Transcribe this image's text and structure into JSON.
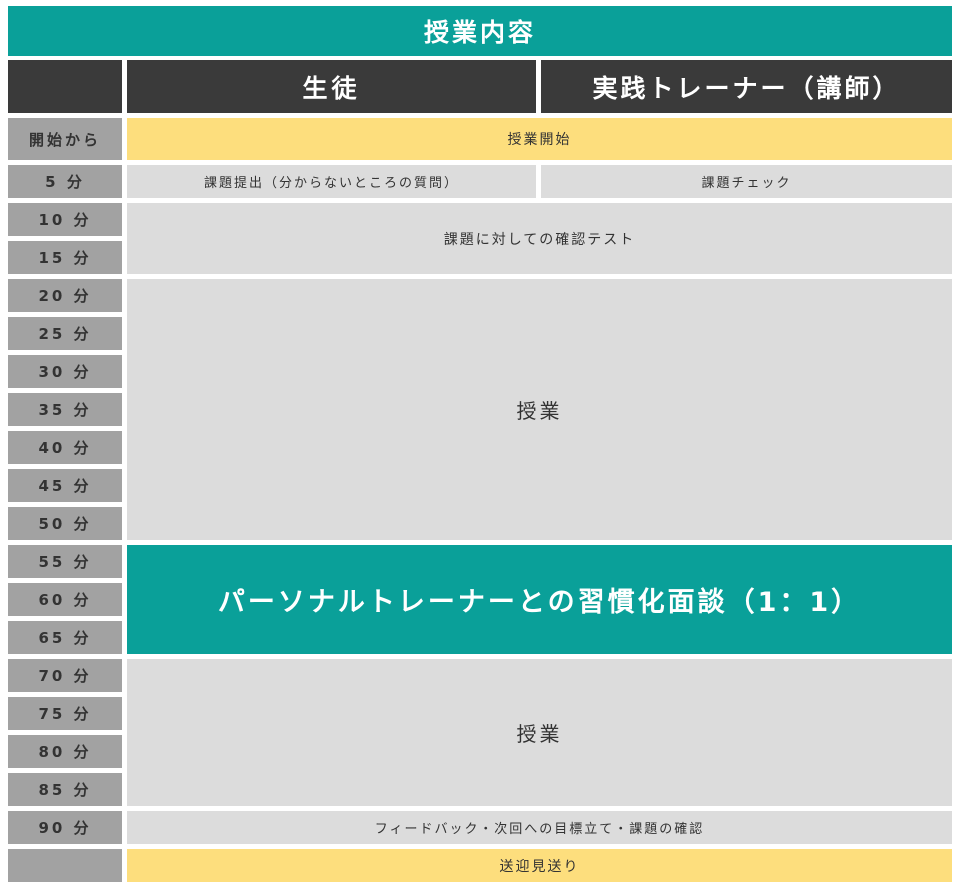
{
  "header": {
    "title": "授業内容",
    "student": "生徒",
    "trainer": "実践トレーナー（講師）"
  },
  "times": [
    "開始から",
    "5 分",
    "10 分",
    "15 分",
    "20 分",
    "25 分",
    "30 分",
    "35 分",
    "40 分",
    "45 分",
    "50 分",
    "55 分",
    "60 分",
    "65 分",
    "70 分",
    "75 分",
    "80 分",
    "85 分",
    "90 分",
    ""
  ],
  "schedule": {
    "start": "授業開始",
    "submit": "課題提出（分からないところの質問）",
    "check": "課題チェック",
    "test": "課題に対しての確認テスト",
    "lesson1": "授業",
    "interview": "パーソナルトレーナーとの習慣化面談（1：1）",
    "lesson2": "授業",
    "feedback": "フィードバック・次回への目標立て・課題の確認",
    "sendoff": "送迎見送り"
  },
  "colors": {
    "teal": "#0aa099",
    "dark": "#3a3a3a",
    "time_grey": "#a2a2a2",
    "cell_grey": "#dcdcdc",
    "yellow": "#fdde7d"
  }
}
